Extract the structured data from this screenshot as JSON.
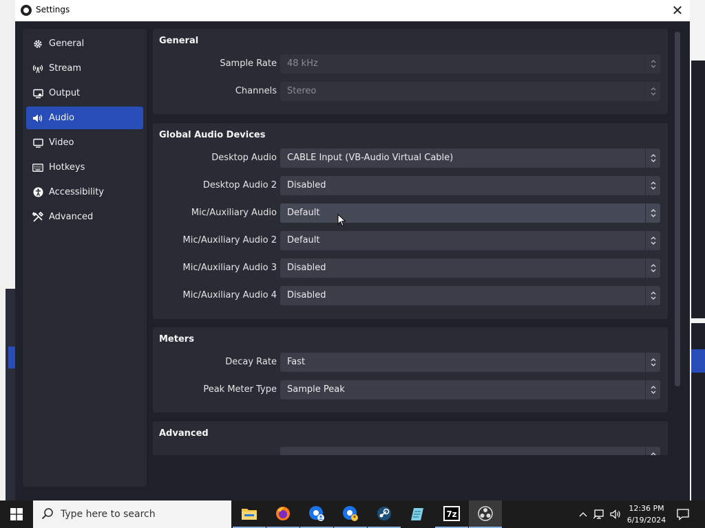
{
  "window": {
    "title": "Settings",
    "close_glyph": "✕"
  },
  "sidebar": {
    "items": [
      {
        "label": "General",
        "icon": "gear-icon"
      },
      {
        "label": "Stream",
        "icon": "antenna-icon"
      },
      {
        "label": "Output",
        "icon": "monitor-output-icon"
      },
      {
        "label": "Audio",
        "icon": "speaker-icon",
        "active": true
      },
      {
        "label": "Video",
        "icon": "monitor-icon"
      },
      {
        "label": "Hotkeys",
        "icon": "keyboard-icon"
      },
      {
        "label": "Accessibility",
        "icon": "accessibility-icon"
      },
      {
        "label": "Advanced",
        "icon": "tools-icon"
      }
    ]
  },
  "sections": {
    "general": {
      "title": "General",
      "sample_rate": {
        "label": "Sample Rate",
        "value": "48 kHz"
      },
      "channels": {
        "label": "Channels",
        "value": "Stereo"
      }
    },
    "devices": {
      "title": "Global Audio Devices",
      "desktop_audio": {
        "label": "Desktop Audio",
        "value": "CABLE Input (VB-Audio Virtual Cable)"
      },
      "desktop_audio_2": {
        "label": "Desktop Audio 2",
        "value": "Disabled"
      },
      "mic_aux": {
        "label": "Mic/Auxiliary Audio",
        "value": "Default"
      },
      "mic_aux_2": {
        "label": "Mic/Auxiliary Audio 2",
        "value": "Default"
      },
      "mic_aux_3": {
        "label": "Mic/Auxiliary Audio 3",
        "value": "Disabled"
      },
      "mic_aux_4": {
        "label": "Mic/Auxiliary Audio 4",
        "value": "Disabled"
      }
    },
    "meters": {
      "title": "Meters",
      "decay_rate": {
        "label": "Decay Rate",
        "value": "Fast"
      },
      "peak_meter_type": {
        "label": "Peak Meter Type",
        "value": "Sample Peak"
      }
    },
    "advanced": {
      "title": "Advanced"
    }
  },
  "taskbar": {
    "search_placeholder": "Type here to search",
    "apps": [
      "file-explorer-icon",
      "firefox-icon",
      "chrome-profile-icon",
      "chrome-profile-2-icon",
      "steam-icon",
      "notepad-icon",
      "7zip-icon",
      "obs-icon"
    ],
    "sevenzip_label": "7z",
    "time": "12:36 PM",
    "date": "6/19/2024"
  },
  "colors": {
    "accent": "#284cb8",
    "window_bg": "#1f212a",
    "panel_bg": "#292c35",
    "combo_bg": "#3b3e48"
  }
}
